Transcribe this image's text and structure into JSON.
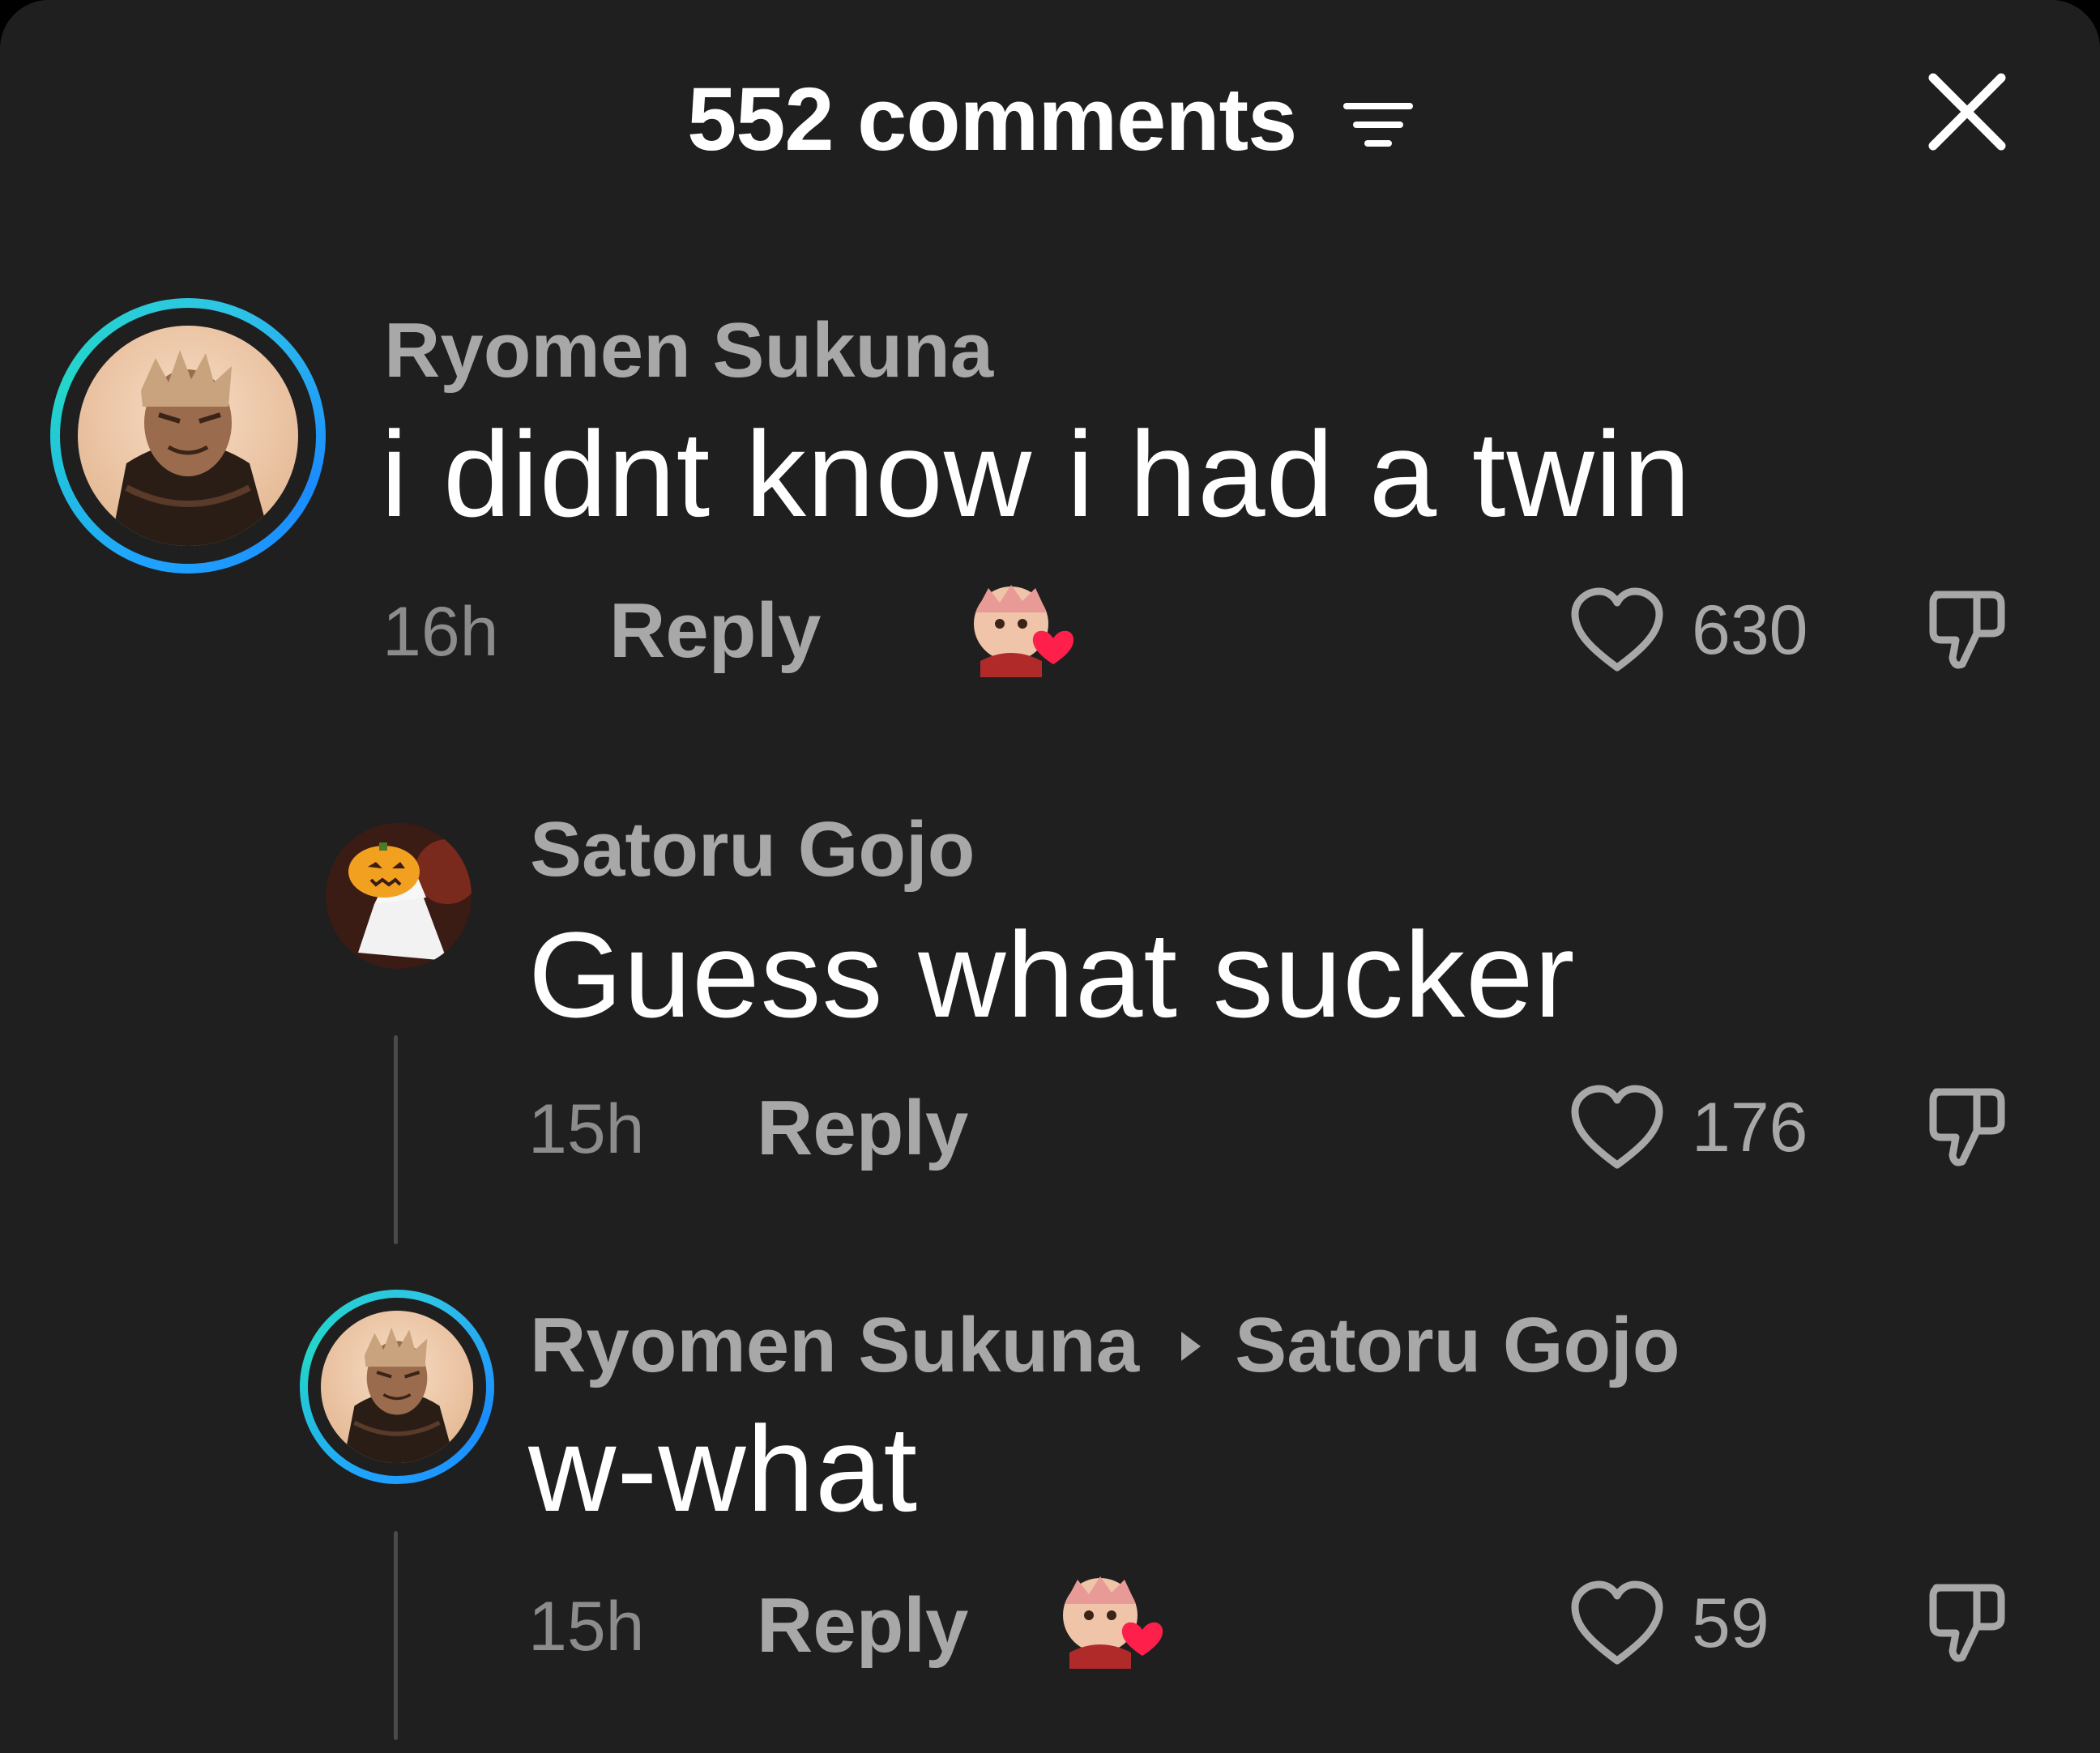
{
  "header": {
    "title": "552 comments",
    "sort_icon": "filter-lines-icon",
    "close_icon": "close-x-icon"
  },
  "colors": {
    "background": "#1f1f1f",
    "story_ring_start": "#1fa3ff",
    "story_ring_end": "#23d6c9",
    "heart_badge": "#ff1f4b"
  },
  "comments": [
    {
      "author": "Ryomen Sukuna",
      "text": "i didnt know i had a twin",
      "time": "16h",
      "reply_label": "Reply",
      "likes": "630",
      "creator_liked": true,
      "has_story_ring": true
    },
    {
      "author": "Satoru Gojo",
      "text": "Guess what sucker",
      "time": "15h",
      "reply_label": "Reply",
      "likes": "176",
      "creator_liked": false,
      "has_story_ring": false
    },
    {
      "author": "Ryomen Sukuna",
      "reply_to": "Satoru Gojo",
      "text": "w-what",
      "time": "15h",
      "reply_label": "Reply",
      "likes": "59",
      "creator_liked": true,
      "has_story_ring": true
    }
  ]
}
